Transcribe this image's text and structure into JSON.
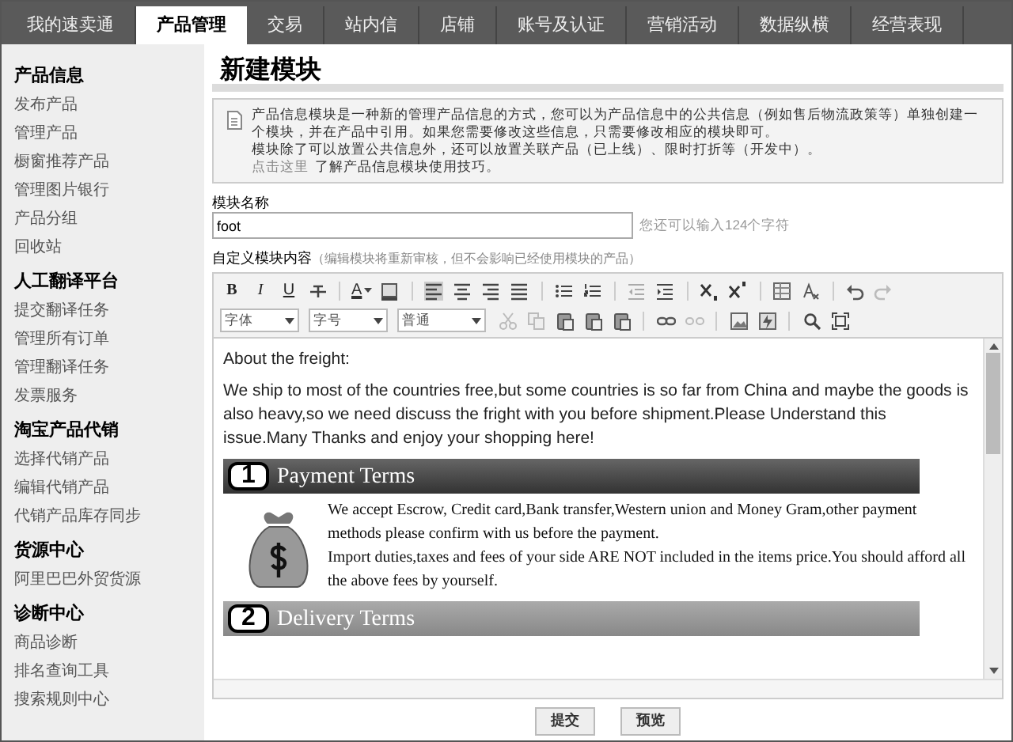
{
  "top_nav": [
    {
      "label": "我的速卖通",
      "selected": false
    },
    {
      "label": "产品管理",
      "selected": true
    },
    {
      "label": "交易",
      "selected": false
    },
    {
      "label": "站内信",
      "selected": false
    },
    {
      "label": "店铺",
      "selected": false
    },
    {
      "label": "账号及认证",
      "selected": false
    },
    {
      "label": "营销活动",
      "selected": false
    },
    {
      "label": "数据纵横",
      "selected": false
    },
    {
      "label": "经营表现",
      "selected": false
    }
  ],
  "sidebar": {
    "sections": [
      {
        "title": "产品信息",
        "items": [
          "发布产品",
          "管理产品",
          "橱窗推荐产品",
          "管理图片银行",
          "产品分组",
          "回收站"
        ]
      },
      {
        "title": "人工翻译平台",
        "items": [
          "提交翻译任务",
          "管理所有订单",
          "管理翻译任务",
          "发票服务"
        ]
      },
      {
        "title": "淘宝产品代销",
        "items": [
          "选择代销产品",
          "编辑代销产品",
          "代销产品库存同步"
        ]
      },
      {
        "title": "货源中心",
        "items": [
          "阿里巴巴外贸货源"
        ]
      },
      {
        "title": "诊断中心",
        "items": [
          "商品诊断",
          "排名查询工具",
          "搜索规则中心"
        ]
      }
    ]
  },
  "page_title": "新建模块",
  "info": {
    "lines": [
      "产品信息模块是一种新的管理产品信息的方式，您可以为产品信息中的公共信息（例如售后物流政策等）单独创建一个模块，并在产品中引用。如果您需要修改这些信息，只需要修改相应的模块即可。",
      "模块除了可以放置公共信息外，还可以放置关联产品（已上线）、限时打折等（开发中）。"
    ],
    "link": "点击这里",
    "link_suffix": "了解产品信息模块使用技巧。"
  },
  "name_field": {
    "label": "模块名称",
    "value": "foot",
    "hint": "您还可以输入124个字符"
  },
  "content_field": {
    "label": "自定义模块内容",
    "note": "（编辑模块将重新审核，但不会影响已经使用模块的产品）"
  },
  "toolbar": {
    "bold": "B",
    "italic": "I",
    "underline": "U",
    "font_color": "A",
    "selects": [
      "字体",
      "字号",
      "普通"
    ]
  },
  "editor": {
    "heading": "About the freight:",
    "paragraph": "We ship to most of the countries free,but some countries is so far from China and maybe the goods is also heavy,so we need discuss the fright with you before shipment.Please Understand this issue.Many Thanks and enjoy your shopping here!",
    "sections": [
      {
        "number": "1",
        "title": "Payment Terms",
        "paragraphs": [
          "We accept Escrow, Credit card,Bank transfer,Western union and Money Gram,other payment methods please confirm with us before the payment.",
          "Import duties,taxes and fees of your side ARE NOT included in the items price.You should afford all the above fees by yourself."
        ]
      },
      {
        "number": "2",
        "title": "Delivery Terms"
      }
    ]
  },
  "buttons": [
    "提交",
    "预览"
  ]
}
